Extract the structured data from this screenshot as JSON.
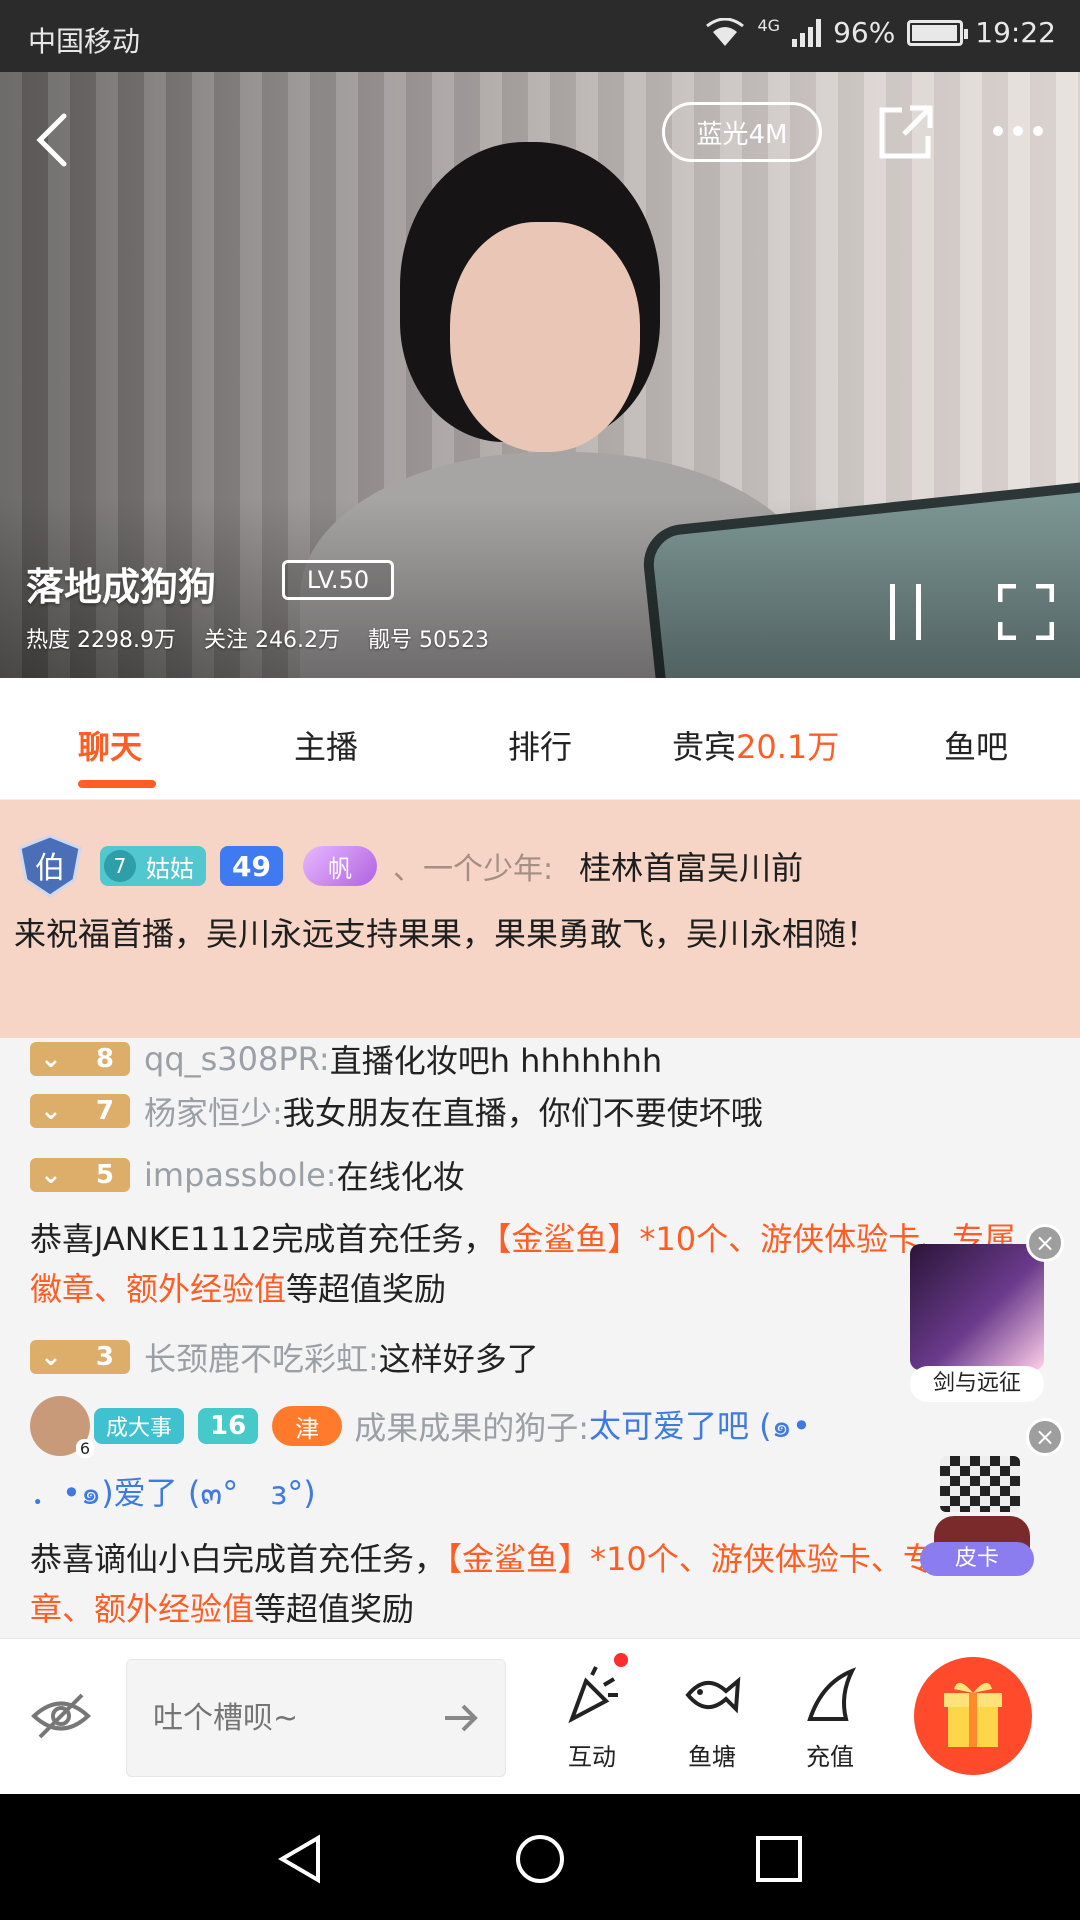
{
  "status_bar": {
    "carrier": "中国移动",
    "network": "4G",
    "battery": "96%",
    "battery_level": 0.96,
    "time": "19:22"
  },
  "player": {
    "quality": "蓝光4M",
    "streamer_name": "落地成狗狗",
    "level": "LV.50",
    "heat": "热度 2298.9万",
    "follows": "关注 246.2万",
    "room_id": "靓号 50523"
  },
  "tabs": [
    {
      "label": "聊天"
    },
    {
      "label": "主播"
    },
    {
      "label": "排行"
    },
    {
      "label": "贵宾",
      "extra": "20.1万"
    },
    {
      "label": "鱼吧"
    }
  ],
  "pinned": {
    "noble_badge": "伯",
    "fan_level": "7",
    "fan_name": "姑姑",
    "user_level": "49",
    "sail_badge": "帆",
    "sender": "、一个少年:",
    "message_start": "桂林首富吴川前",
    "message_rest": "来祝福首播，吴川永远支持果果，果果勇敢飞，吴川永相随！"
  },
  "chat": {
    "line1": {
      "level": "8",
      "user": "qq_s308PR:",
      "text": "直播化妆吧h hhhhhhh"
    },
    "line2": {
      "level": "7",
      "user": "杨家恒少:",
      "text": "我女朋友在直播，你们不要使坏哦"
    },
    "line3": {
      "level": "5",
      "user": "impassbole:",
      "text": "在线化妆"
    },
    "sys1": {
      "prefix": "恭喜JANKE1112完成首充任务，",
      "gift": "【金鲨鱼】*10个、游侠体验卡、专属徽章、额外经验值",
      "suffix": "等超值奖励"
    },
    "line4": {
      "level": "3",
      "user": "长颈鹿不吃彩虹:",
      "text": "这样好多了"
    },
    "line5": {
      "avatar_num": "6",
      "fan_name": "成大事",
      "user_level": "16",
      "badge": "津",
      "user": "成果成果的狗子:",
      "text": "太可爱了吧 (๑•",
      "text2": "．•๑)爱了 (๓°　з°)"
    },
    "sys2": {
      "prefix": "恭喜谪仙小白完成首充任务，",
      "gift": "【金鲨鱼】*10个、游侠体验卡、专属徽章、额外经验值",
      "suffix": "等超值奖励"
    }
  },
  "ads": {
    "ad1_label": "剑与远征",
    "ad2_label": "皮卡"
  },
  "input": {
    "placeholder": "吐个槽呗~"
  },
  "toolbar": {
    "interact": "互动",
    "fishpond": "鱼塘",
    "recharge": "充值"
  }
}
